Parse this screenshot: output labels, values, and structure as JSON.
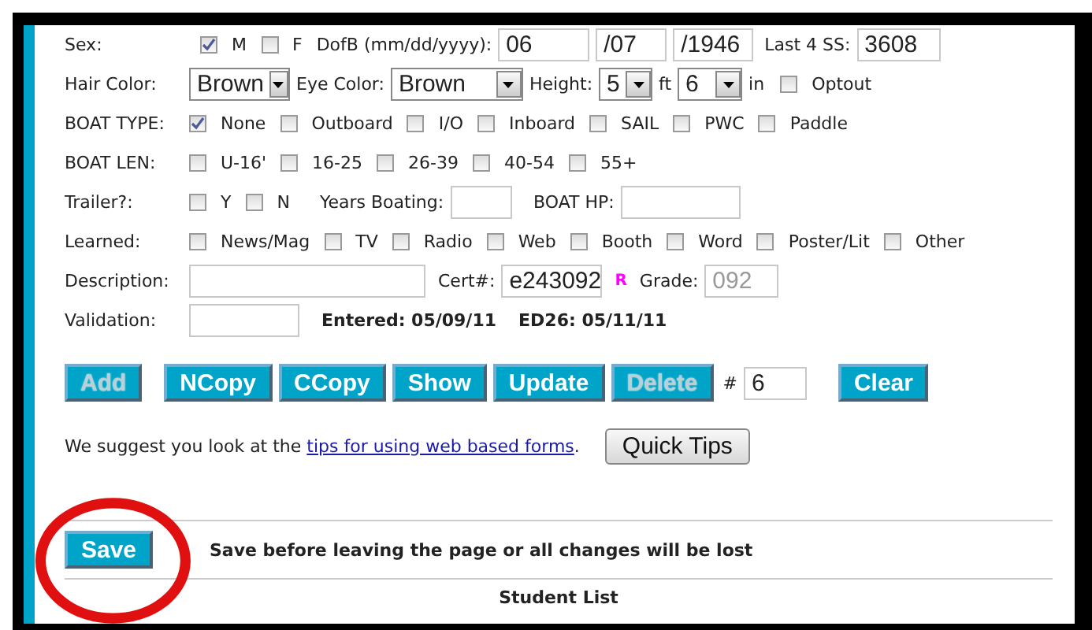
{
  "sex_row": {
    "label": "Sex:",
    "options": [
      {
        "label": "M",
        "checked": true
      },
      {
        "label": "F",
        "checked": false
      }
    ],
    "dob_label": "DofB (mm/dd/yyyy):",
    "dob_month": "06",
    "dob_sep_1": "/",
    "dob_day": "07",
    "dob_sep_2": "/",
    "dob_year": "1946",
    "ss_label": "Last 4 SS:",
    "ss_value": "3608"
  },
  "appearance_row": {
    "hair_label": "Hair Color:",
    "hair_value": "Brown",
    "eye_label": "Eye Color:",
    "eye_value": "Brown",
    "height_label": "Height:",
    "feet_value": "5",
    "feet_unit": "ft",
    "inches_value": "6",
    "inches_unit": "in",
    "optout": {
      "label": "Optout",
      "checked": false
    }
  },
  "checkbox_rows": [
    {
      "label": "BOAT TYPE:",
      "options": [
        {
          "label": "None",
          "checked": true
        },
        {
          "label": "Outboard",
          "checked": false
        },
        {
          "label": "I/O",
          "checked": false
        },
        {
          "label": "Inboard",
          "checked": false
        },
        {
          "label": "SAIL",
          "checked": false
        },
        {
          "label": "PWC",
          "checked": false
        },
        {
          "label": "Paddle",
          "checked": false
        }
      ]
    },
    {
      "label": "BOAT LEN:",
      "options": [
        {
          "label": "U-16'",
          "checked": false
        },
        {
          "label": "16-25",
          "checked": false
        },
        {
          "label": "26-39",
          "checked": false
        },
        {
          "label": "40-54",
          "checked": false
        },
        {
          "label": "55+",
          "checked": false
        }
      ]
    },
    {
      "label": "Trailer?:",
      "options": [
        {
          "label": "Y",
          "checked": false
        },
        {
          "label": "N",
          "checked": false
        }
      ],
      "extra": [
        {
          "label": "Years Boating:"
        },
        {
          "label": "BOAT HP:"
        }
      ]
    },
    {
      "label": "Learned:",
      "options": [
        {
          "label": "News/Mag",
          "checked": false
        },
        {
          "label": "TV",
          "checked": false
        },
        {
          "label": "Radio",
          "checked": false
        },
        {
          "label": "Web",
          "checked": false
        },
        {
          "label": "Booth",
          "checked": false
        },
        {
          "label": "Word",
          "checked": false
        },
        {
          "label": "Poster/Lit",
          "checked": false
        },
        {
          "label": "Other",
          "checked": false
        }
      ]
    }
  ],
  "description_row": {
    "label": "Description:",
    "cert_label": "Cert#:",
    "cert_value": "e243092",
    "flag": "R",
    "grade_label": "Grade:",
    "grade_value": "092",
    "grade_disabled": true
  },
  "validation_row": {
    "label": "Validation:",
    "entered": "Entered: 05/09/11",
    "ed26": "ED26: 05/11/11"
  },
  "buttons": [
    {
      "label": "Add",
      "disabled": true
    },
    {
      "label": "NCopy",
      "disabled": false
    },
    {
      "label": "CCopy",
      "disabled": false
    },
    {
      "label": "Show",
      "disabled": false
    },
    {
      "label": "Update",
      "disabled": false
    },
    {
      "label": "Delete",
      "disabled": true
    }
  ],
  "record_number": {
    "label": "#",
    "value": "6"
  },
  "clear_button": "Clear",
  "tips": {
    "text_before": "We suggest you look at the",
    "link": "tips for using web based forms",
    "text_after": ".",
    "button": "Quick Tips"
  },
  "save": {
    "button": "Save",
    "message": "Save before leaving the page or all changes will be lost"
  },
  "student_list_title": "Student List"
}
